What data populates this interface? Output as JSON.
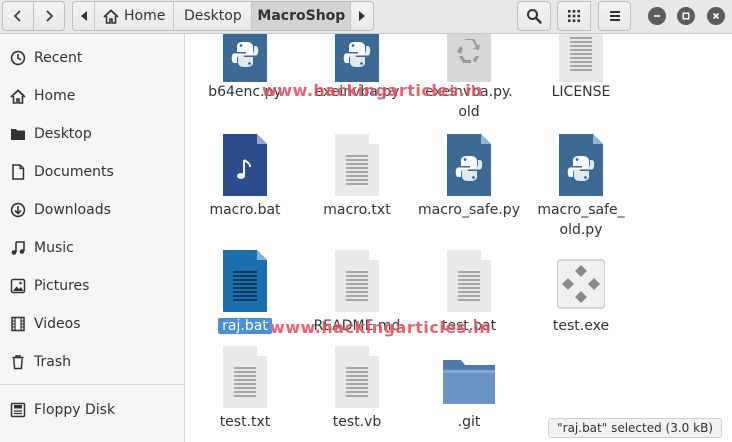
{
  "header": {
    "path": [
      {
        "label": "Home",
        "icon": "home-icon"
      },
      {
        "label": "Desktop"
      },
      {
        "label": "MacroShop",
        "current": true
      }
    ]
  },
  "sidebar": {
    "items": [
      {
        "name": "recent",
        "label": "Recent",
        "icon": "clock-icon"
      },
      {
        "name": "home",
        "label": "Home",
        "icon": "home-icon"
      },
      {
        "name": "desktop",
        "label": "Desktop",
        "icon": "folder-icon"
      },
      {
        "name": "documents",
        "label": "Documents",
        "icon": "document-icon"
      },
      {
        "name": "downloads",
        "label": "Downloads",
        "icon": "download-icon"
      },
      {
        "name": "music",
        "label": "Music",
        "icon": "music-note-icon"
      },
      {
        "name": "pictures",
        "label": "Pictures",
        "icon": "picture-icon"
      },
      {
        "name": "videos",
        "label": "Videos",
        "icon": "film-icon"
      },
      {
        "name": "trash",
        "label": "Trash",
        "icon": "trash-icon"
      },
      {
        "name": "floppy-disk",
        "label": "Floppy Disk",
        "icon": "floppy-icon"
      }
    ]
  },
  "files": [
    {
      "name": "b64enc.py",
      "label": "b64enc.py",
      "type": "python"
    },
    {
      "name": "exeinvba.py",
      "label": "exeinvba.py",
      "type": "python"
    },
    {
      "name": "exeinvba.py.old",
      "label": "exeinvba.py.\nold",
      "type": "recycle"
    },
    {
      "name": "LICENSE",
      "label": "LICENSE",
      "type": "text"
    },
    {
      "name": "macro.bat",
      "label": "macro.bat",
      "type": "audio"
    },
    {
      "name": "macro.txt",
      "label": "macro.txt",
      "type": "text"
    },
    {
      "name": "macro_safe.py",
      "label": "macro_safe.py",
      "type": "python"
    },
    {
      "name": "macro_safe_old.py",
      "label": "macro_safe_\nold.py",
      "type": "python"
    },
    {
      "name": "raj.bat",
      "label": "raj.bat",
      "type": "document-blue",
      "selected": true
    },
    {
      "name": "README.md",
      "label": "README.md",
      "type": "text"
    },
    {
      "name": "test.bat",
      "label": "test.bat",
      "type": "text"
    },
    {
      "name": "test.exe",
      "label": "test.exe",
      "type": "executable"
    },
    {
      "name": "test.txt",
      "label": "test.txt",
      "type": "text"
    },
    {
      "name": "test.vb",
      "label": "test.vb",
      "type": "text"
    },
    {
      "name": ".git",
      "label": ".git",
      "type": "folder"
    }
  ],
  "watermarks": [
    "www.hackingarticles.in",
    "www.hackingarticles.in"
  ],
  "status": "\"raj.bat\" selected  (3.0 kB)",
  "colors": {
    "python": "#3d6a95",
    "audio": "#2c4d8b",
    "document_blue": "#1b6fad",
    "selection": "#4a90d9",
    "folder": "#6b93c4",
    "watermark": "#e8475a"
  }
}
